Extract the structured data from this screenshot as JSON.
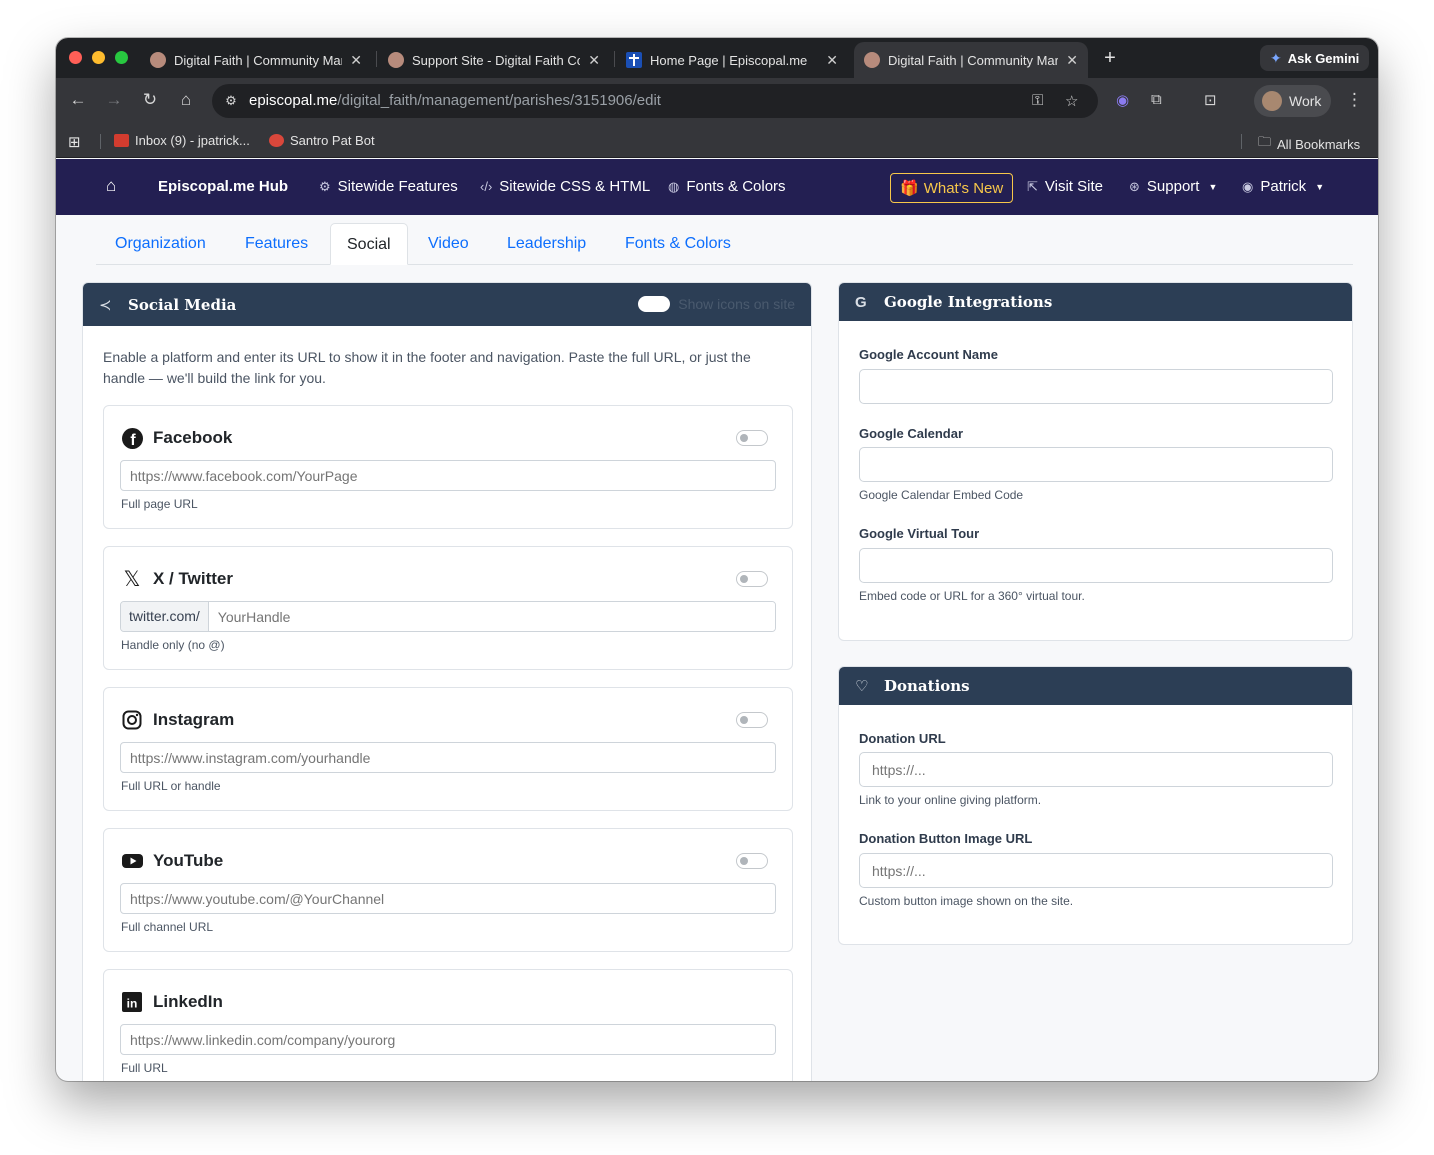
{
  "browser": {
    "tabs": [
      {
        "title": "Digital Faith | Community Mar",
        "close": "✕"
      },
      {
        "title": "Support Site - Digital Faith Cc",
        "close": "✕"
      },
      {
        "title": "Home Page | Episcopal.me",
        "close": "✕"
      },
      {
        "title": "Digital Faith | Community Mar",
        "close": "✕"
      }
    ],
    "new_tab": "+",
    "gemini_label": "Ask Gemini",
    "url_host": "episcopal.me",
    "url_path": "/digital_faith/management/parishes/3151906/edit",
    "profile_label": "Work",
    "bookmarks": [
      {
        "label": "Inbox (9) - jpatrick..."
      },
      {
        "label": "Santro Pat Bot"
      }
    ],
    "all_bookmarks": "All Bookmarks"
  },
  "appnav": {
    "brand": "Episcopal.me Hub",
    "items": [
      "Sitewide Features",
      "Sitewide CSS & HTML",
      "Fonts & Colors"
    ],
    "whats_new": "What's New",
    "visit_site": "Visit Site",
    "support": "Support",
    "user": "Patrick"
  },
  "tabs": [
    "Organization",
    "Features",
    "Social",
    "Video",
    "Leadership",
    "Fonts & Colors"
  ],
  "social": {
    "title": "Social Media",
    "show_icons_label": "Show icons on site",
    "intro": "Enable a platform and enter its URL to show it in the footer and navigation. Paste the full URL, or just the handle — we'll build the link for you.",
    "platforms": [
      {
        "name": "Facebook",
        "placeholder": "https://www.facebook.com/YourPage",
        "help": "Full page URL"
      },
      {
        "name": "X / Twitter",
        "prefix": "twitter.com/",
        "placeholder": "YourHandle",
        "help": "Handle only (no @)"
      },
      {
        "name": "Instagram",
        "placeholder": "https://www.instagram.com/yourhandle",
        "help": "Full URL or handle"
      },
      {
        "name": "YouTube",
        "placeholder": "https://www.youtube.com/@YourChannel",
        "help": "Full channel URL"
      },
      {
        "name": "LinkedIn",
        "placeholder": "https://www.linkedin.com/company/yourorg",
        "help": "Full URL"
      }
    ]
  },
  "google": {
    "title": "Google Integrations",
    "account_label": "Google Account Name",
    "calendar_label": "Google Calendar",
    "calendar_help": "Google Calendar Embed Code",
    "tour_label": "Google Virtual Tour",
    "tour_help": "Embed code or URL for a 360° virtual tour."
  },
  "donations": {
    "title": "Donations",
    "url_label": "Donation URL",
    "url_placeholder": "https://...",
    "url_help": "Link to your online giving platform.",
    "image_label": "Donation Button Image URL",
    "image_placeholder": "https://...",
    "image_help": "Custom button image shown on the site."
  }
}
